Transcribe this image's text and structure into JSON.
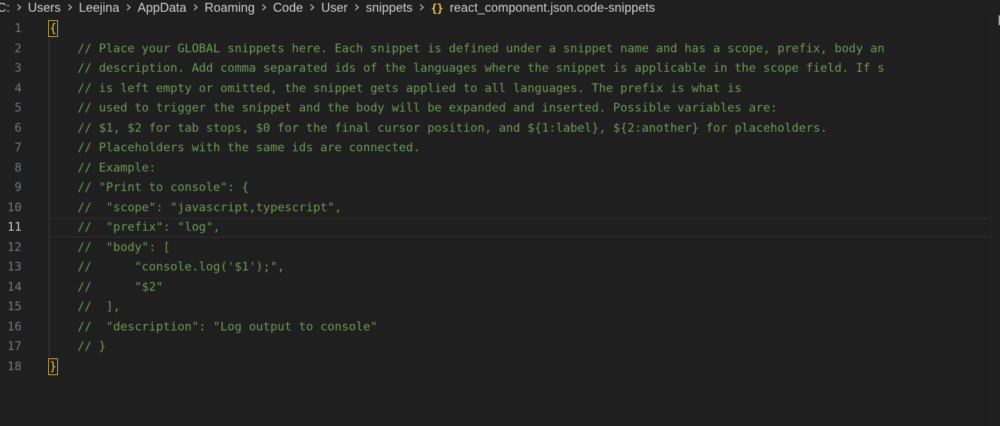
{
  "breadcrumb": {
    "items": [
      "C:",
      "Users",
      "Leejina",
      "AppData",
      "Roaming",
      "Code",
      "User",
      "snippets"
    ],
    "file_icon": "{}",
    "file_name": "react_component.json.code-snippets"
  },
  "editor": {
    "active_line": "11",
    "lines": [
      {
        "number": "1",
        "text": "{"
      },
      {
        "number": "2",
        "text": "    // Place your GLOBAL snippets here. Each snippet is defined under a snippet name and has a scope, prefix, body an"
      },
      {
        "number": "3",
        "text": "    // description. Add comma separated ids of the languages where the snippet is applicable in the scope field. If s"
      },
      {
        "number": "4",
        "text": "    // is left empty or omitted, the snippet gets applied to all languages. The prefix is what is"
      },
      {
        "number": "5",
        "text": "    // used to trigger the snippet and the body will be expanded and inserted. Possible variables are:"
      },
      {
        "number": "6",
        "text": "    // $1, $2 for tab stops, $0 for the final cursor position, and ${1:label}, ${2:another} for placeholders."
      },
      {
        "number": "7",
        "text": "    // Placeholders with the same ids are connected."
      },
      {
        "number": "8",
        "text": "    // Example:"
      },
      {
        "number": "9",
        "text": "    // \"Print to console\": {"
      },
      {
        "number": "10",
        "text": "    //  \"scope\": \"javascript,typescript\","
      },
      {
        "number": "11",
        "text": "    //  \"prefix\": \"log\","
      },
      {
        "number": "12",
        "text": "    //  \"body\": ["
      },
      {
        "number": "13",
        "text": "    //      \"console.log('$1');\","
      },
      {
        "number": "14",
        "text": "    //      \"$2\""
      },
      {
        "number": "15",
        "text": "    //  ],"
      },
      {
        "number": "16",
        "text": "    //  \"description\": \"Log output to console\""
      },
      {
        "number": "17",
        "text": "    // }"
      },
      {
        "number": "18",
        "text": "}"
      }
    ]
  },
  "colors": {
    "background": "#1f1f1f",
    "comment": "#6a9955",
    "bracket_highlight": "#e8c745",
    "line_number": "#6e7681",
    "line_number_active": "#cccccc"
  }
}
